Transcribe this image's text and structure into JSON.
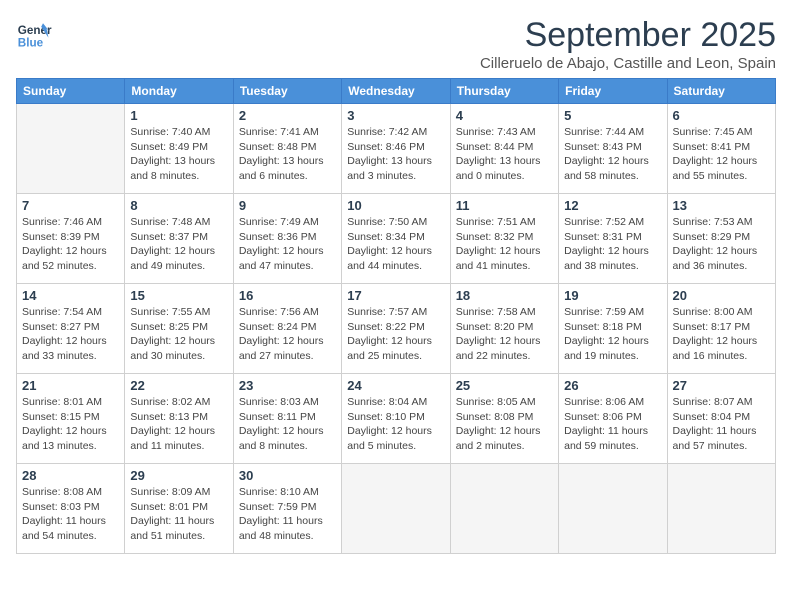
{
  "logo": {
    "line1": "General",
    "line2": "Blue"
  },
  "title": "September 2025",
  "subtitle": "Cilleruelo de Abajo, Castille and Leon, Spain",
  "days_of_week": [
    "Sunday",
    "Monday",
    "Tuesday",
    "Wednesday",
    "Thursday",
    "Friday",
    "Saturday"
  ],
  "weeks": [
    [
      {
        "day": "",
        "empty": true
      },
      {
        "day": "1",
        "sunrise": "7:40 AM",
        "sunset": "8:49 PM",
        "daylight": "13 hours and 8 minutes."
      },
      {
        "day": "2",
        "sunrise": "7:41 AM",
        "sunset": "8:48 PM",
        "daylight": "13 hours and 6 minutes."
      },
      {
        "day": "3",
        "sunrise": "7:42 AM",
        "sunset": "8:46 PM",
        "daylight": "13 hours and 3 minutes."
      },
      {
        "day": "4",
        "sunrise": "7:43 AM",
        "sunset": "8:44 PM",
        "daylight": "13 hours and 0 minutes."
      },
      {
        "day": "5",
        "sunrise": "7:44 AM",
        "sunset": "8:43 PM",
        "daylight": "12 hours and 58 minutes."
      },
      {
        "day": "6",
        "sunrise": "7:45 AM",
        "sunset": "8:41 PM",
        "daylight": "12 hours and 55 minutes."
      }
    ],
    [
      {
        "day": "7",
        "sunrise": "7:46 AM",
        "sunset": "8:39 PM",
        "daylight": "12 hours and 52 minutes."
      },
      {
        "day": "8",
        "sunrise": "7:48 AM",
        "sunset": "8:37 PM",
        "daylight": "12 hours and 49 minutes."
      },
      {
        "day": "9",
        "sunrise": "7:49 AM",
        "sunset": "8:36 PM",
        "daylight": "12 hours and 47 minutes."
      },
      {
        "day": "10",
        "sunrise": "7:50 AM",
        "sunset": "8:34 PM",
        "daylight": "12 hours and 44 minutes."
      },
      {
        "day": "11",
        "sunrise": "7:51 AM",
        "sunset": "8:32 PM",
        "daylight": "12 hours and 41 minutes."
      },
      {
        "day": "12",
        "sunrise": "7:52 AM",
        "sunset": "8:31 PM",
        "daylight": "12 hours and 38 minutes."
      },
      {
        "day": "13",
        "sunrise": "7:53 AM",
        "sunset": "8:29 PM",
        "daylight": "12 hours and 36 minutes."
      }
    ],
    [
      {
        "day": "14",
        "sunrise": "7:54 AM",
        "sunset": "8:27 PM",
        "daylight": "12 hours and 33 minutes."
      },
      {
        "day": "15",
        "sunrise": "7:55 AM",
        "sunset": "8:25 PM",
        "daylight": "12 hours and 30 minutes."
      },
      {
        "day": "16",
        "sunrise": "7:56 AM",
        "sunset": "8:24 PM",
        "daylight": "12 hours and 27 minutes."
      },
      {
        "day": "17",
        "sunrise": "7:57 AM",
        "sunset": "8:22 PM",
        "daylight": "12 hours and 25 minutes."
      },
      {
        "day": "18",
        "sunrise": "7:58 AM",
        "sunset": "8:20 PM",
        "daylight": "12 hours and 22 minutes."
      },
      {
        "day": "19",
        "sunrise": "7:59 AM",
        "sunset": "8:18 PM",
        "daylight": "12 hours and 19 minutes."
      },
      {
        "day": "20",
        "sunrise": "8:00 AM",
        "sunset": "8:17 PM",
        "daylight": "12 hours and 16 minutes."
      }
    ],
    [
      {
        "day": "21",
        "sunrise": "8:01 AM",
        "sunset": "8:15 PM",
        "daylight": "12 hours and 13 minutes."
      },
      {
        "day": "22",
        "sunrise": "8:02 AM",
        "sunset": "8:13 PM",
        "daylight": "12 hours and 11 minutes."
      },
      {
        "day": "23",
        "sunrise": "8:03 AM",
        "sunset": "8:11 PM",
        "daylight": "12 hours and 8 minutes."
      },
      {
        "day": "24",
        "sunrise": "8:04 AM",
        "sunset": "8:10 PM",
        "daylight": "12 hours and 5 minutes."
      },
      {
        "day": "25",
        "sunrise": "8:05 AM",
        "sunset": "8:08 PM",
        "daylight": "12 hours and 2 minutes."
      },
      {
        "day": "26",
        "sunrise": "8:06 AM",
        "sunset": "8:06 PM",
        "daylight": "11 hours and 59 minutes."
      },
      {
        "day": "27",
        "sunrise": "8:07 AM",
        "sunset": "8:04 PM",
        "daylight": "11 hours and 57 minutes."
      }
    ],
    [
      {
        "day": "28",
        "sunrise": "8:08 AM",
        "sunset": "8:03 PM",
        "daylight": "11 hours and 54 minutes."
      },
      {
        "day": "29",
        "sunrise": "8:09 AM",
        "sunset": "8:01 PM",
        "daylight": "11 hours and 51 minutes."
      },
      {
        "day": "30",
        "sunrise": "8:10 AM",
        "sunset": "7:59 PM",
        "daylight": "11 hours and 48 minutes."
      },
      {
        "day": "",
        "empty": true
      },
      {
        "day": "",
        "empty": true
      },
      {
        "day": "",
        "empty": true
      },
      {
        "day": "",
        "empty": true
      }
    ]
  ]
}
